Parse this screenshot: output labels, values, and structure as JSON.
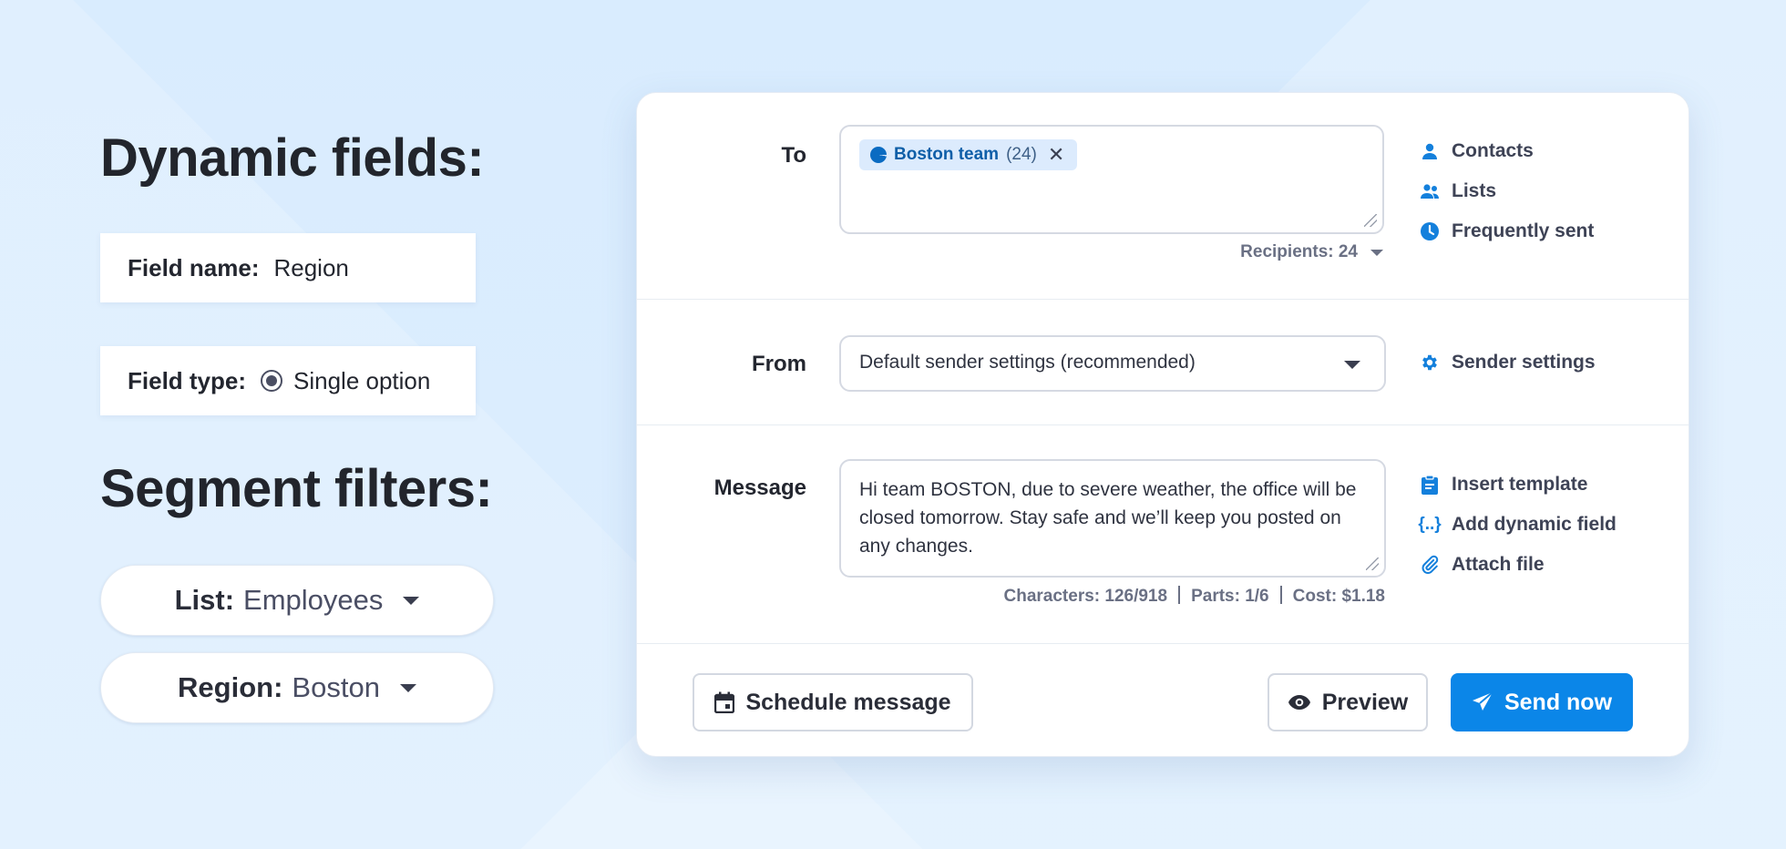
{
  "left": {
    "dynamic_heading": "Dynamic fields:",
    "field_name_label": "Field name:",
    "field_name_value": "Region",
    "field_type_label": "Field type:",
    "field_type_value": "Single option",
    "segment_heading": "Segment filters:",
    "filters": [
      {
        "label": "List:",
        "value": "Employees"
      },
      {
        "label": "Region:",
        "value": "Boston"
      }
    ]
  },
  "compose": {
    "to_label": "To",
    "recipient_chip": {
      "name": "Boston team",
      "count": "(24)"
    },
    "recipients_summary": "Recipients: 24",
    "to_links": [
      "Contacts",
      "Lists",
      "Frequently sent"
    ],
    "from_label": "From",
    "from_value": "Default sender settings (recommended)",
    "sender_settings": "Sender settings",
    "message_label": "Message",
    "message_text": "Hi team BOSTON, due to severe weather, the office will be closed tomorrow. Stay safe and we’ll keep you posted on any changes.",
    "characters": "Characters: 126/918",
    "parts": "Parts: 1/6",
    "cost": "Cost: $1.18",
    "message_links": [
      "Insert template",
      "Add dynamic field",
      "Attach file"
    ],
    "schedule_button": "Schedule message",
    "preview_button": "Preview",
    "send_button": "Send now"
  },
  "colors": {
    "accent": "#0b86e8",
    "chip_bg": "#dcebfd",
    "icon_blue": "#1480dc"
  }
}
